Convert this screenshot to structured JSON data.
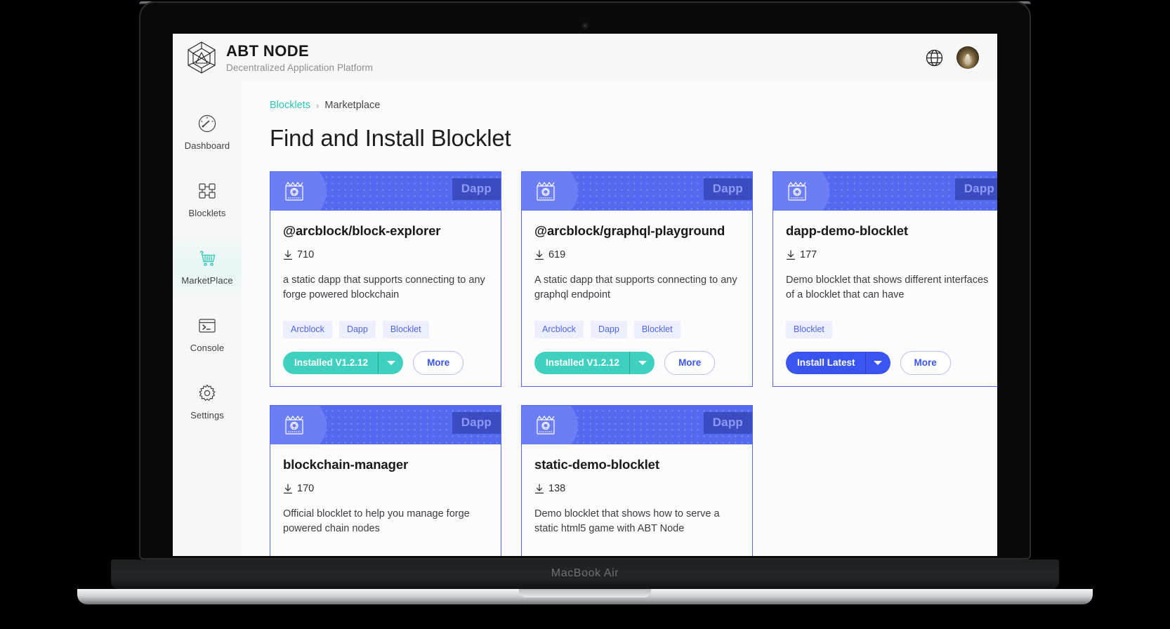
{
  "device": {
    "label": "MacBook Air"
  },
  "header": {
    "logo_icon": "abt-cube-logo",
    "title": "ABT NODE",
    "subtitle": "Decentralized Application Platform",
    "globe_icon": "globe-icon",
    "avatar_icon": "user-avatar"
  },
  "sidebar": {
    "items": [
      {
        "label": "Dashboard",
        "icon": "gauge-icon",
        "active": false
      },
      {
        "label": "Blocklets",
        "icon": "blocks-icon",
        "active": false
      },
      {
        "label": "MarketPlace",
        "icon": "cart-icon",
        "active": true
      },
      {
        "label": "Console",
        "icon": "terminal-icon",
        "active": false
      },
      {
        "label": "Settings",
        "icon": "gear-icon",
        "active": false
      }
    ],
    "active_color": "#2ec4b6"
  },
  "breadcrumb": {
    "root": "Blocklets",
    "separator": "›",
    "current": "Marketplace"
  },
  "page": {
    "title": "Find and Install Blocklet"
  },
  "labels": {
    "more": "More",
    "dapp_badge": "Dapp",
    "download_icon": "download-icon"
  },
  "colors": {
    "accent_blue": "#5468f0",
    "accent_teal": "#3fd0c0",
    "badge_bg": "#3b4cc0",
    "tag_bg": "#eceffd",
    "tag_text": "#4f63ee"
  },
  "cards": [
    {
      "badge": "Dapp",
      "title": "@arcblock/block-explorer",
      "downloads": "710",
      "description": "a static dapp that supports connecting to any forge powered blockchain",
      "tags": [
        "Arcblock",
        "Dapp",
        "Blocklet"
      ],
      "action_label": "Installed V1.2.12",
      "action_state": "installed",
      "more_label": "More"
    },
    {
      "badge": "Dapp",
      "title": "@arcblock/graphql-playground",
      "downloads": "619",
      "description": "A static dapp that supports connecting to any graphql endpoint",
      "tags": [
        "Arcblock",
        "Dapp",
        "Blocklet"
      ],
      "action_label": "Installed V1.2.12",
      "action_state": "installed",
      "more_label": "More"
    },
    {
      "badge": "Dapp",
      "title": "dapp-demo-blocklet",
      "downloads": "177",
      "description": "Demo blocklet that shows different interfaces of a blocklet that can have",
      "tags": [
        "Blocklet"
      ],
      "action_label": "Install Latest",
      "action_state": "install",
      "more_label": "More"
    },
    {
      "badge": "Dapp",
      "title": "blockchain-manager",
      "downloads": "170",
      "description": "Official blocklet to help you manage forge powered chain nodes",
      "tags": [],
      "action_label": "",
      "action_state": "none",
      "more_label": ""
    },
    {
      "badge": "Dapp",
      "title": "static-demo-blocklet",
      "downloads": "138",
      "description": "Demo blocklet that shows how to serve a static html5 game with ABT Node",
      "tags": [],
      "action_label": "",
      "action_state": "none",
      "more_label": ""
    }
  ]
}
